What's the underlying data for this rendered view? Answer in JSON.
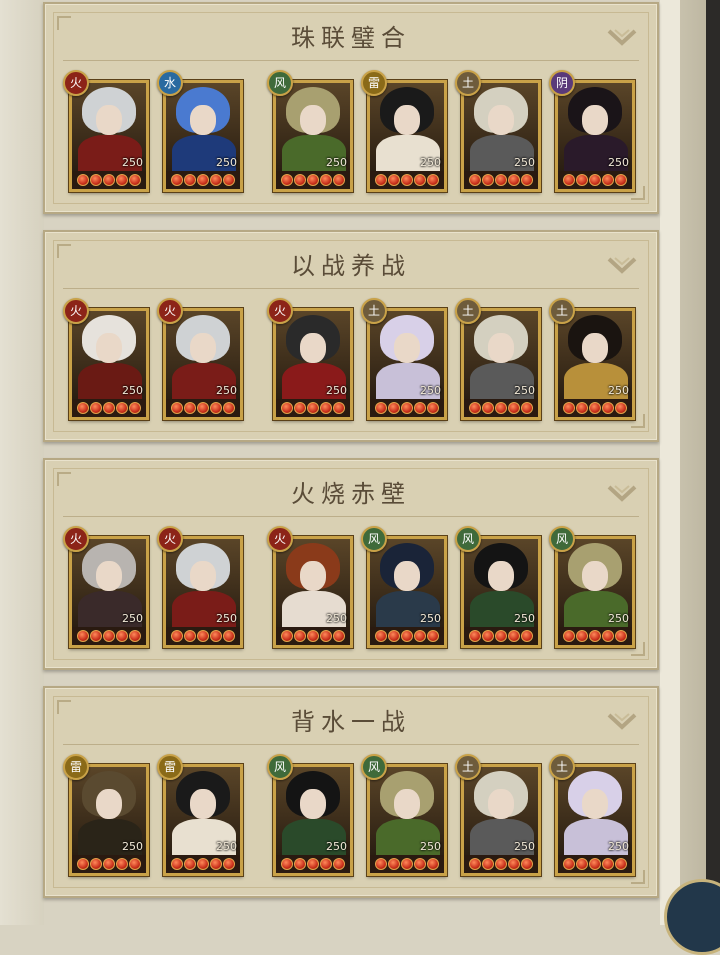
{
  "colors": {
    "fire": "#8c2418",
    "water": "#2a6aa0",
    "wind": "#3f6a3a",
    "thunder": "#8a6a18",
    "earth": "#6e5c3c",
    "yin": "#5a3a7a"
  },
  "panels": [
    {
      "title": "珠联璧合",
      "heroes": [
        {
          "element": "火",
          "type": "fire",
          "level": "250",
          "hair": "#cfd2d4",
          "body": "#7a1c18"
        },
        {
          "element": "水",
          "type": "water",
          "level": "250",
          "hair": "#4a7ad0",
          "body": "#1e3a7a"
        },
        {
          "element": "风",
          "type": "wind",
          "level": "250",
          "hair": "#a8a070",
          "body": "#4a6a2a"
        },
        {
          "element": "雷",
          "type": "thunder",
          "level": "250",
          "hair": "#1a1a1a",
          "body": "#e8e0d0"
        },
        {
          "element": "土",
          "type": "earth",
          "level": "250",
          "hair": "#d4d0c0",
          "body": "#5a5a5a"
        },
        {
          "element": "阴",
          "type": "yin",
          "level": "250",
          "hair": "#1a1418",
          "body": "#2a1a2a"
        }
      ]
    },
    {
      "title": "以战养战",
      "heroes": [
        {
          "element": "火",
          "type": "fire",
          "level": "250",
          "hair": "#e6e2dc",
          "body": "#6a1a14"
        },
        {
          "element": "火",
          "type": "fire",
          "level": "250",
          "hair": "#cfd2d4",
          "body": "#7a1c18"
        },
        {
          "element": "火",
          "type": "fire",
          "level": "250",
          "hair": "#2a2a2a",
          "body": "#8a1a1a"
        },
        {
          "element": "土",
          "type": "earth",
          "level": "250",
          "hair": "#d8d0e8",
          "body": "#c8c0d8"
        },
        {
          "element": "土",
          "type": "earth",
          "level": "250",
          "hair": "#d4d0c0",
          "body": "#5a5a5a"
        },
        {
          "element": "土",
          "type": "earth",
          "level": "250",
          "hair": "#1a1410",
          "body": "#b8903a"
        }
      ]
    },
    {
      "title": "火烧赤壁",
      "heroes": [
        {
          "element": "火",
          "type": "fire",
          "level": "250",
          "hair": "#b8b4b0",
          "body": "#3a2a2a"
        },
        {
          "element": "火",
          "type": "fire",
          "level": "250",
          "hair": "#cfd2d4",
          "body": "#7a1c18"
        },
        {
          "element": "火",
          "type": "fire",
          "level": "250",
          "hair": "#8a3a1a",
          "body": "#e6dcd0"
        },
        {
          "element": "风",
          "type": "wind",
          "level": "250",
          "hair": "#1a2438",
          "body": "#2a3a4a"
        },
        {
          "element": "风",
          "type": "wind",
          "level": "250",
          "hair": "#141414",
          "body": "#2a4a2a"
        },
        {
          "element": "风",
          "type": "wind",
          "level": "250",
          "hair": "#a8a070",
          "body": "#4a6a2a"
        }
      ]
    },
    {
      "title": "背水一战",
      "heroes": [
        {
          "element": "雷",
          "type": "thunder",
          "level": "250",
          "hair": "#5a4a30",
          "body": "#2a2418"
        },
        {
          "element": "雷",
          "type": "thunder",
          "level": "250",
          "hair": "#1a1a1a",
          "body": "#e8e0d0"
        },
        {
          "element": "风",
          "type": "wind",
          "level": "250",
          "hair": "#141414",
          "body": "#2a4a2a"
        },
        {
          "element": "风",
          "type": "wind",
          "level": "250",
          "hair": "#a8a070",
          "body": "#4a6a2a"
        },
        {
          "element": "土",
          "type": "earth",
          "level": "250",
          "hair": "#d4d0c0",
          "body": "#5a5a5a"
        },
        {
          "element": "土",
          "type": "earth",
          "level": "250",
          "hair": "#d8d0e8",
          "body": "#c8c0d8"
        }
      ]
    }
  ]
}
